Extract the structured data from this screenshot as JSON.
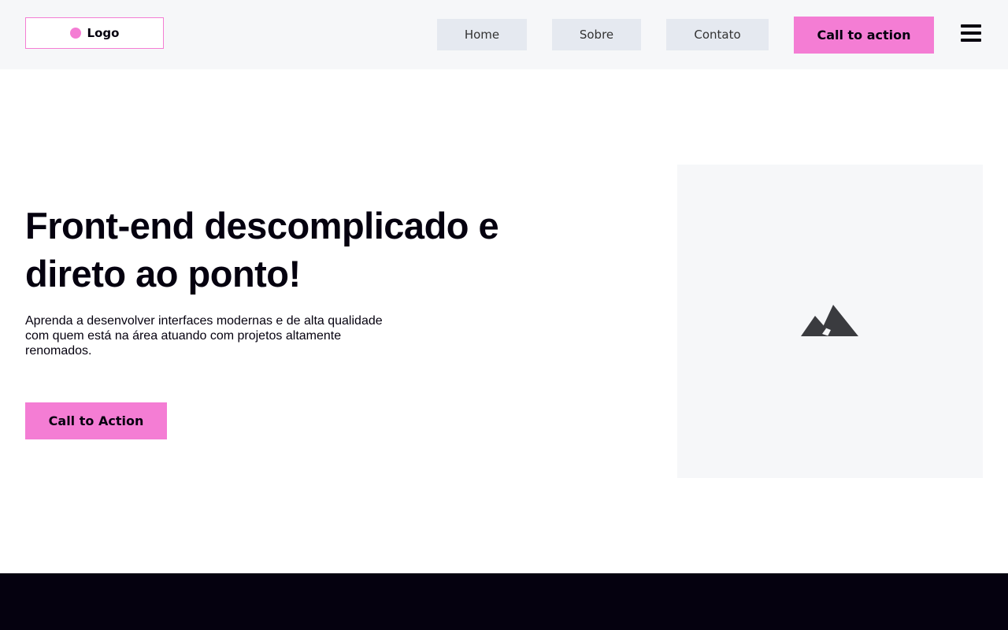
{
  "header": {
    "logo_label": "Logo",
    "nav": {
      "home": "Home",
      "sobre": "Sobre",
      "contato": "Contato"
    },
    "cta_label": "Call to action"
  },
  "hero": {
    "title": "Front-end descomplicado e direto ao ponto!",
    "description": "Aprenda a desenvolver interfaces modernas e de alta qualidade com quem está na área atuando com projetos altamente renomados.",
    "cta_label": "Call to Action",
    "image_icon": "mountain-image-icon"
  },
  "colors": {
    "accent": "#f47dd4",
    "dark": "#05010f",
    "header_bg": "#f6f7f9",
    "nav_bg": "#e5e9f0"
  }
}
